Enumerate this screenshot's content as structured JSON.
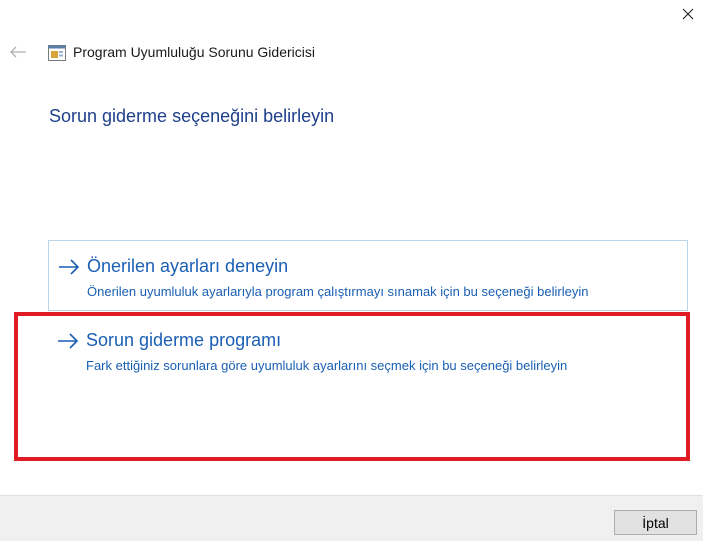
{
  "window": {
    "title": "Program Uyumluluğu Sorunu Gidericisi",
    "close_icon": "close-icon",
    "back_icon": "back-arrow-icon",
    "app_icon": "compatibility-troubleshooter-icon"
  },
  "page": {
    "heading": "Sorun giderme seçeneğini belirleyin"
  },
  "options": [
    {
      "icon": "arrow-right-icon",
      "title": "Önerilen ayarları deneyin",
      "description": "Önerilen uyumluluk ayarlarıyla program çalıştırmayı sınamak için bu seçeneği belirleyin"
    },
    {
      "icon": "arrow-right-icon",
      "title": "Sorun giderme programı",
      "description": "Fark ettiğiniz sorunlara göre uyumluluk ayarlarını seçmek için bu seçeneği belirleyin"
    }
  ],
  "footer": {
    "cancel_label": "İptal"
  },
  "colors": {
    "heading": "#1e3f8a",
    "link": "#1a5fb4",
    "highlight": "#e01b24",
    "option_border": "#b9d5ec"
  }
}
